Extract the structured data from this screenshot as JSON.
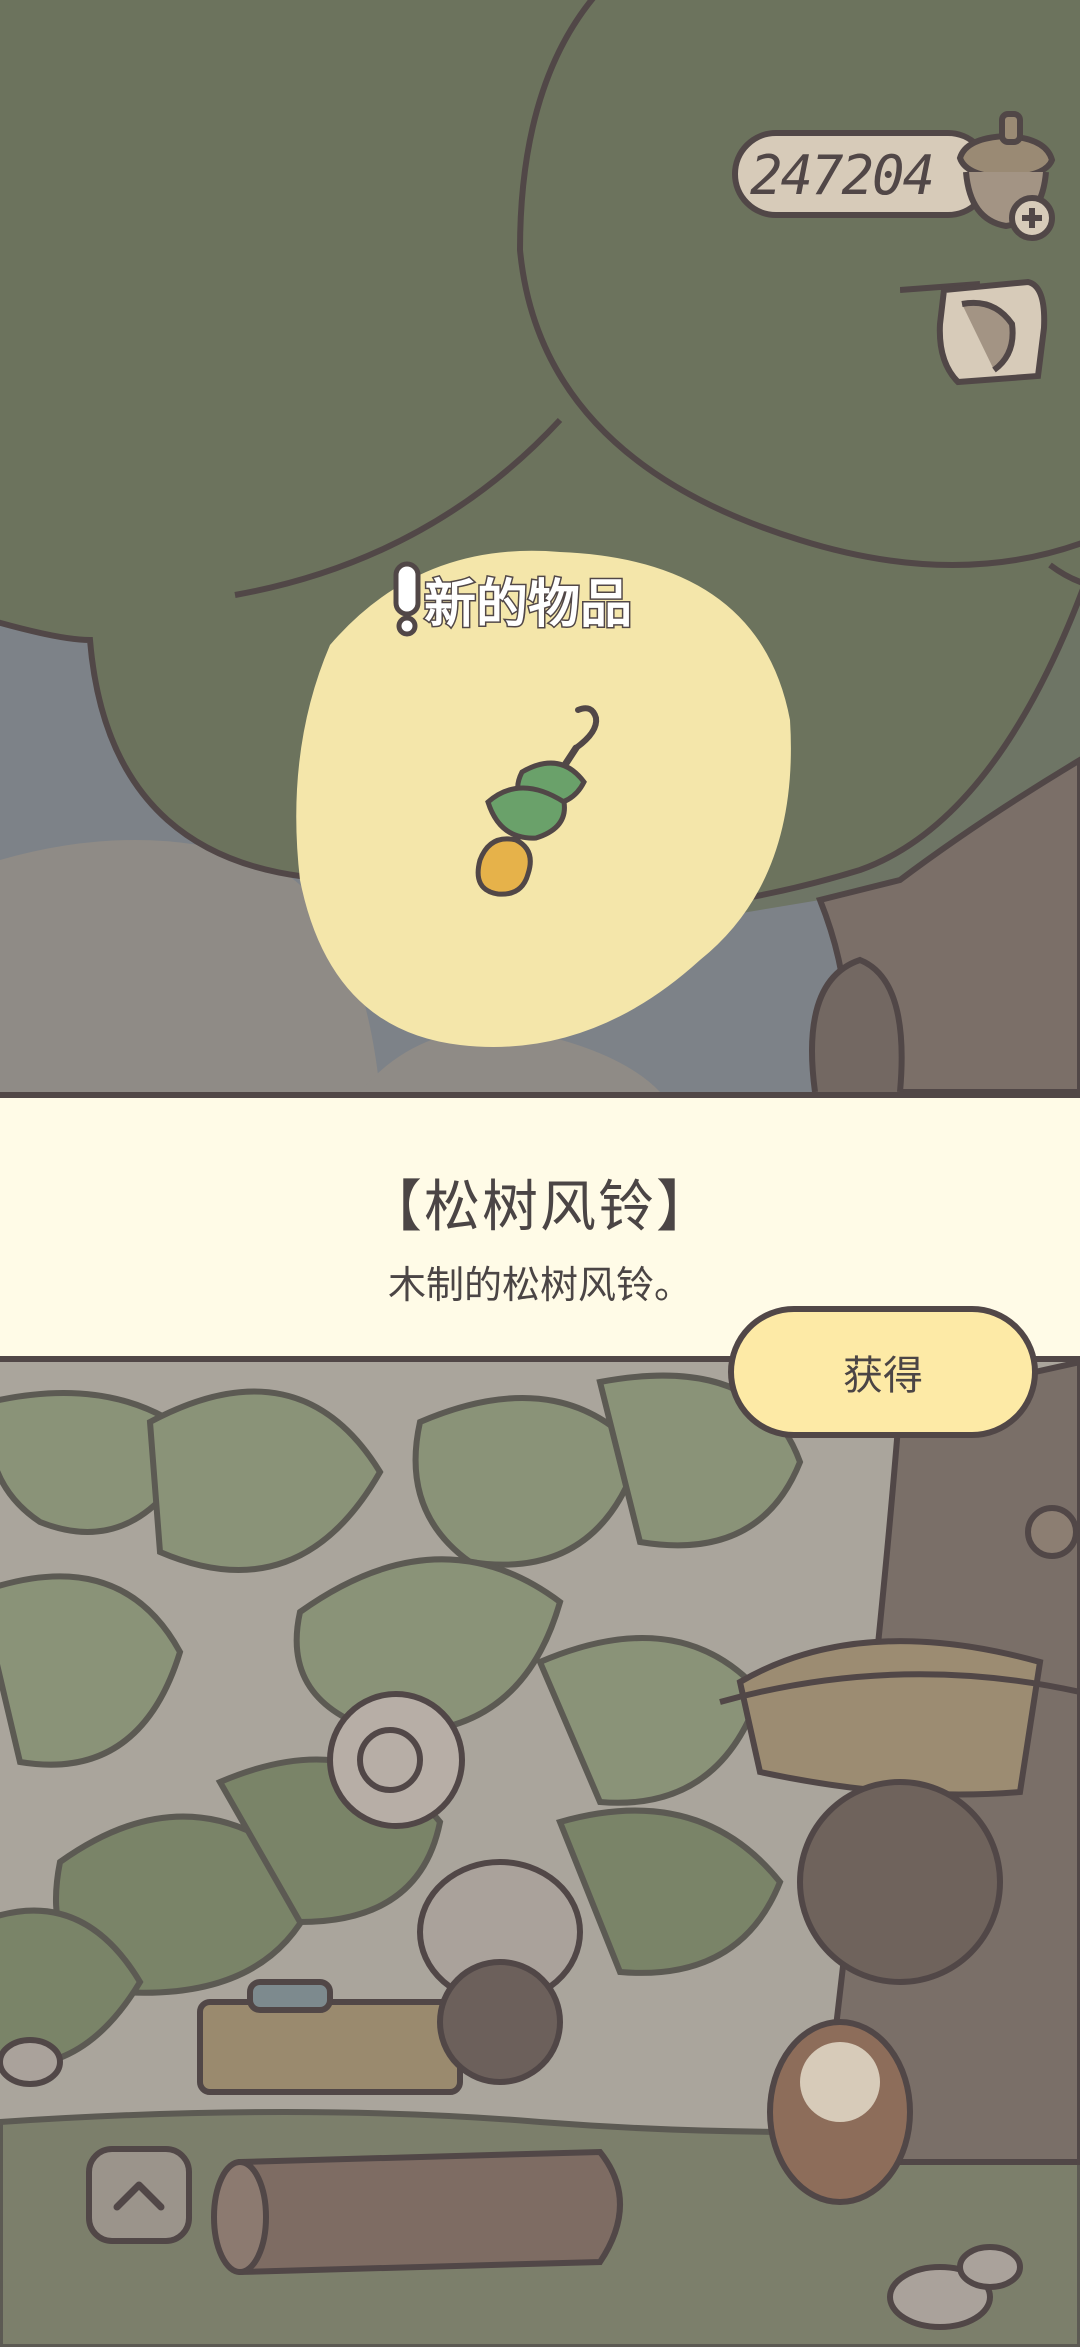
{
  "hud": {
    "acorn_count": "247204",
    "acorn_icon": "acorn-icon",
    "add_icon": "plus-icon",
    "letter_icon": "letter-icon"
  },
  "popup": {
    "new_item_label": "新的物品",
    "exclaim": "!",
    "item_name": "【松树风铃】",
    "item_desc": "木制的松树风铃。",
    "obtain_label": "获得",
    "item_icon": "pine-wind-chime-icon"
  },
  "nav": {
    "back_icon": "chevron-up-icon"
  },
  "colors": {
    "outline": "#514747",
    "banner_bg": "#fffbe7",
    "button_bg": "#fdeaa6",
    "glow": "#f4e6aa",
    "tree": "#6c735d"
  }
}
